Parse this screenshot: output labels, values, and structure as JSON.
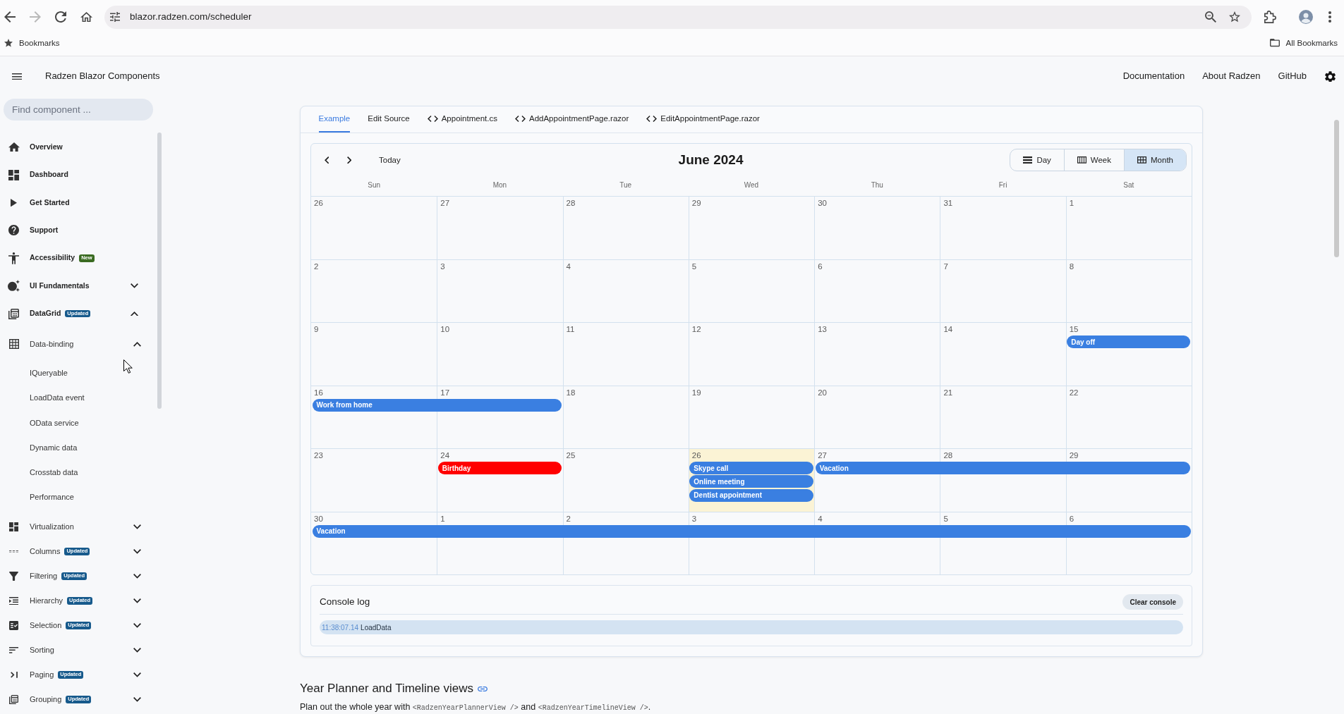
{
  "browser": {
    "url": "blazor.radzen.com/scheduler",
    "forward_disabled": true,
    "bookmarks": "Bookmarks",
    "all_bookmarks": "All Bookmarks"
  },
  "header": {
    "title": "Radzen Blazor Components",
    "links": [
      "Documentation",
      "About Radzen",
      "GitHub"
    ]
  },
  "sidebar": {
    "search": {
      "placeholder": "Find component ..."
    },
    "items": [
      {
        "label": "Overview"
      },
      {
        "label": "Dashboard"
      },
      {
        "label": "Get Started"
      },
      {
        "label": "Support"
      },
      {
        "label": "Accessibility",
        "badge": {
          "text": "New",
          "color": "#3a6b21"
        }
      },
      {
        "label": "UI Fundamentals",
        "expanded": false
      },
      {
        "label": "DataGrid",
        "badge": {
          "text": "Updated",
          "color": "#175a8c"
        },
        "expanded": true,
        "children": [
          {
            "label": "Data-binding",
            "expanded": true,
            "children": [
              {
                "label": "IQueryable"
              },
              {
                "label": "LoadData event"
              },
              {
                "label": "OData service"
              },
              {
                "label": "Dynamic data"
              },
              {
                "label": "Crosstab data"
              },
              {
                "label": "Performance"
              }
            ]
          },
          {
            "label": "Virtualization",
            "expanded": false
          },
          {
            "label": "Columns",
            "badge": {
              "text": "Updated",
              "color": "#175a8c"
            },
            "expanded": false
          },
          {
            "label": "Filtering",
            "badge": {
              "text": "Updated",
              "color": "#175a8c"
            },
            "expanded": false
          },
          {
            "label": "Hierarchy",
            "badge": {
              "text": "Updated",
              "color": "#175a8c"
            },
            "expanded": false
          },
          {
            "label": "Selection",
            "badge": {
              "text": "Updated",
              "color": "#175a8c"
            },
            "expanded": false
          },
          {
            "label": "Sorting",
            "expanded": false
          },
          {
            "label": "Paging",
            "badge": {
              "text": "Updated",
              "color": "#175a8c"
            },
            "expanded": false
          },
          {
            "label": "Grouping",
            "badge": {
              "text": "Updated",
              "color": "#175a8c"
            },
            "expanded": false
          }
        ]
      }
    ]
  },
  "tabs": [
    {
      "label": "Example",
      "kind": "view",
      "selected": true
    },
    {
      "label": "Edit Source",
      "kind": "view",
      "selected": false
    },
    {
      "label": "Appointment.cs",
      "kind": "file",
      "selected": false
    },
    {
      "label": "AddAppointmentPage.razor",
      "kind": "file",
      "selected": false
    },
    {
      "label": "EditAppointmentPage.razor",
      "kind": "file",
      "selected": false
    }
  ],
  "scheduler": {
    "today_button": "Today",
    "title": "June 2024",
    "views": [
      {
        "label": "Day",
        "selected": false
      },
      {
        "label": "Week",
        "selected": false
      },
      {
        "label": "Month",
        "selected": true
      }
    ],
    "weekdays": [
      "Sun",
      "Mon",
      "Tue",
      "Wed",
      "Thu",
      "Fri",
      "Sat"
    ],
    "weeks": [
      {
        "days": [
          {
            "date": "26",
            "today": false
          },
          {
            "date": "27",
            "today": false
          },
          {
            "date": "28",
            "today": false
          },
          {
            "date": "29",
            "today": false
          },
          {
            "date": "30",
            "today": false
          },
          {
            "date": "31",
            "today": false
          },
          {
            "date": "1",
            "today": false
          }
        ]
      },
      {
        "days": [
          {
            "date": "2",
            "today": false
          },
          {
            "date": "3",
            "today": false
          },
          {
            "date": "4",
            "today": false
          },
          {
            "date": "5",
            "today": false
          },
          {
            "date": "6",
            "today": false
          },
          {
            "date": "7",
            "today": false
          },
          {
            "date": "8",
            "today": false
          }
        ]
      },
      {
        "days": [
          {
            "date": "9",
            "today": false
          },
          {
            "date": "10",
            "today": false
          },
          {
            "date": "11",
            "today": false
          },
          {
            "date": "12",
            "today": false
          },
          {
            "date": "13",
            "today": false
          },
          {
            "date": "14",
            "today": false
          },
          {
            "date": "15",
            "today": false,
            "events": [
              {
                "kind": "start",
                "title": "Day off",
                "color": "#3a7fe1"
              }
            ]
          }
        ]
      },
      {
        "days": [
          {
            "date": "16",
            "today": false,
            "events": [
              {
                "kind": "start",
                "title": "Work from home",
                "color": "#3a7fe1"
              }
            ]
          },
          {
            "date": "17",
            "today": false,
            "events": [
              {
                "kind": "continuation"
              }
            ]
          },
          {
            "date": "18",
            "today": false
          },
          {
            "date": "19",
            "today": false
          },
          {
            "date": "20",
            "today": false
          },
          {
            "date": "21",
            "today": false
          },
          {
            "date": "22",
            "today": false
          }
        ]
      },
      {
        "days": [
          {
            "date": "23",
            "today": false
          },
          {
            "date": "24",
            "today": false,
            "events": [
              {
                "kind": "start",
                "title": "Birthday",
                "color": "#ff0000"
              }
            ]
          },
          {
            "date": "25",
            "today": false
          },
          {
            "date": "26",
            "today": true,
            "events": [
              {
                "kind": "start",
                "title": "Skype call",
                "color": "#3a7fe1"
              },
              {
                "kind": "start",
                "title": "Online meeting",
                "color": "#3a7fe1"
              },
              {
                "kind": "start",
                "title": "Dentist appointment",
                "color": "#3a7fe1"
              }
            ]
          },
          {
            "date": "27",
            "today": false,
            "events": [
              {
                "kind": "start",
                "title": "Vacation",
                "color": "#3a7fe1"
              }
            ]
          },
          {
            "date": "28",
            "today": false,
            "events": [
              {
                "kind": "continuation"
              }
            ]
          },
          {
            "date": "29",
            "today": false,
            "events": [
              {
                "kind": "continuation"
              }
            ]
          }
        ]
      },
      {
        "days": [
          {
            "date": "30",
            "today": false,
            "events": [
              {
                "kind": "start",
                "title": "Vacation",
                "color": "#3a7fe1"
              }
            ]
          },
          {
            "date": "1",
            "today": false,
            "events": [
              {
                "kind": "continuation"
              }
            ]
          },
          {
            "date": "2",
            "today": false,
            "events": [
              {
                "kind": "continuation"
              }
            ]
          },
          {
            "date": "3",
            "today": false,
            "events": [
              {
                "kind": "continuation"
              }
            ]
          },
          {
            "date": "4",
            "today": false,
            "events": [
              {
                "kind": "continuation"
              }
            ]
          },
          {
            "date": "5",
            "today": false,
            "events": [
              {
                "kind": "continuation"
              }
            ]
          },
          {
            "date": "6",
            "today": false,
            "events": [
              {
                "kind": "continuation"
              }
            ]
          }
        ]
      }
    ]
  },
  "console": {
    "title": "Console log",
    "clear_button": "Clear console",
    "entries": [
      {
        "time": "11:38:07.14",
        "message": "LoadData"
      }
    ]
  },
  "section": {
    "heading": "Year Planner and Timeline views",
    "paragraph": [
      {
        "kind": "text",
        "text": "Plan out the whole year with "
      },
      {
        "kind": "code",
        "text": "<RadzenYearPlannerView />"
      },
      {
        "kind": "text",
        "text": " and "
      },
      {
        "kind": "code",
        "text": "<RadzenYearTimelineView />"
      },
      {
        "kind": "text",
        "text": "."
      }
    ]
  }
}
